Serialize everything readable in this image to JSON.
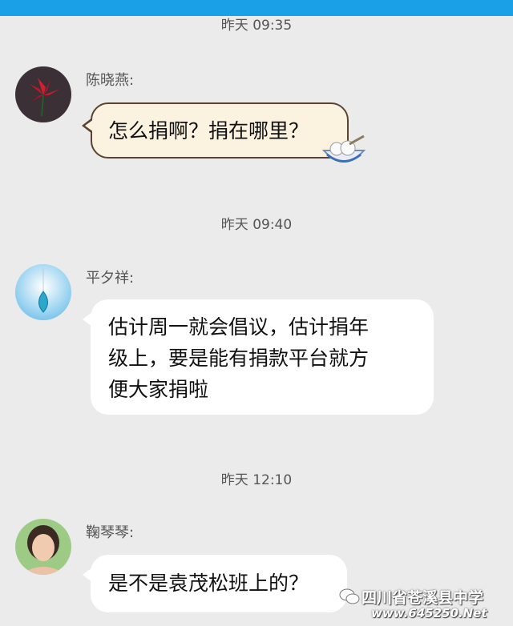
{
  "messages": [
    {
      "time": "昨天 09:35",
      "sender": "陈晓燕:",
      "text": "怎么捐啊？捐在哪里？"
    },
    {
      "time": "昨天 09:40",
      "sender": "平夕祥:",
      "lines": [
        "估计周一就会倡议，估计捐年",
        "级上，要是能有捐款平台就方",
        "便大家捐啦"
      ]
    },
    {
      "time": "昨天 12:10",
      "sender": "鞠琴琴:",
      "text": "是不是袁茂松班上的？"
    }
  ],
  "watermark": {
    "name": "四川省苍溪县中学",
    "site": "www.645250.Net"
  },
  "colors": {
    "accent": "#1aa0e6",
    "background": "#ebebeb",
    "bubble": "#ffffff",
    "special_bubble": "#fbf3e0"
  }
}
